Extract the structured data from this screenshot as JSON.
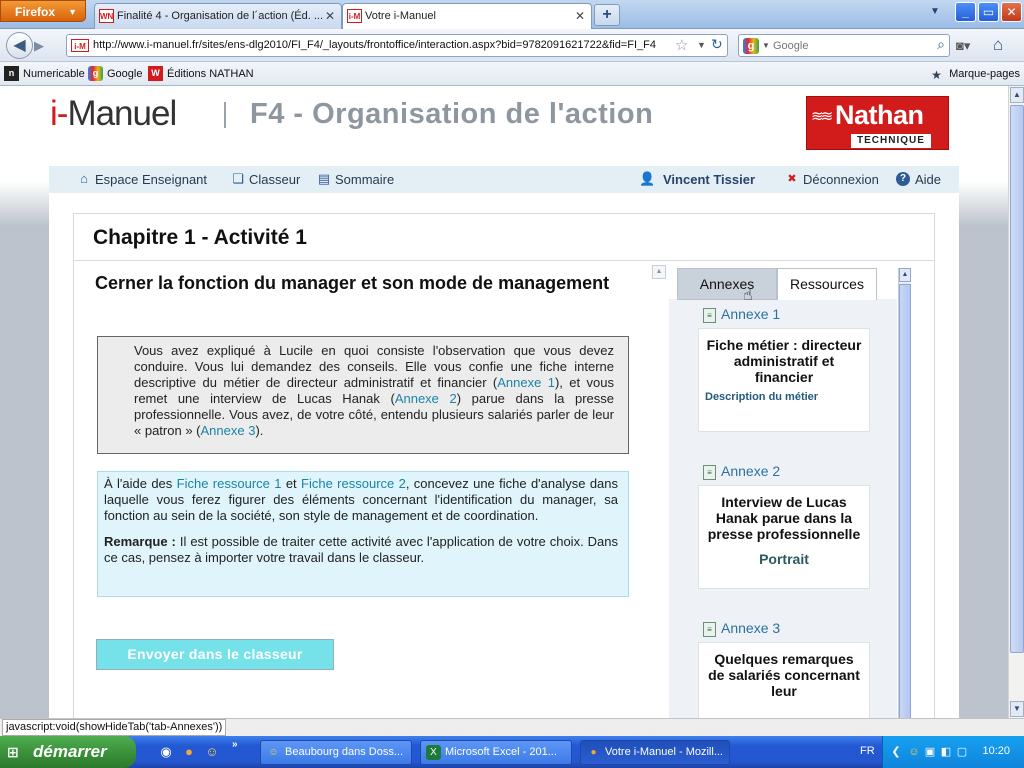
{
  "browser": {
    "menu_button": "Firefox",
    "tabs": [
      {
        "title": "Finalité 4 - Organisation de l´action (Éd. ...",
        "icon": "nathan-favicon-icon"
      },
      {
        "title": "Votre i-Manuel",
        "icon": "imanuel-favicon-icon"
      }
    ],
    "url": "http://www.i-manuel.fr/sites/ens-dlg2010/FI_F4/_layouts/frontoffice/interaction.aspx?bid=9782091621722&fid=FI_F4",
    "search_placeholder": "Google",
    "bookmarks": [
      "Numericable",
      "Google",
      "Éditions NATHAN"
    ],
    "bookmarks_menu": "Marque-pages",
    "status_text": "javascript:void(showHideTab('tab-Annexes'))"
  },
  "header": {
    "logo_prefix": "i-",
    "logo_name": "Manuel",
    "title": "F4 - Organisation de l'action",
    "publisher": "Nathan",
    "publisher_sub": "TECHNIQUE"
  },
  "nav": {
    "espace": "Espace Enseignant",
    "classeur": "Classeur",
    "sommaire": "Sommaire",
    "user": "Vincent Tissier",
    "logout": "Déconnexion",
    "help": "Aide"
  },
  "chapter": {
    "title": "Chapitre 1 - Activité 1"
  },
  "activity": {
    "title": "Cerner la fonction du manager et son mode de management",
    "context_1": "Vous avez expliqué à Lucile en quoi consiste l'observation que vous devez conduire. Vous lui demandez des conseils. Elle vous confie une fiche interne descriptive du métier de directeur administratif et financier (",
    "link_annexe1": "Annexe 1",
    "context_2": "), et vous remet une interview de Lucas Hanak (",
    "link_annexe2": "Annexe 2",
    "context_3": ") parue dans la presse professionnelle. Vous avez, de votre côté, entendu plusieurs salariés parler de leur « patron » (",
    "link_annexe3": "Annexe 3",
    "context_4": ").",
    "consigne_1": "À l'aide des ",
    "link_fiche1": "Fiche ressource 1",
    "consigne_2": " et ",
    "link_fiche2": "Fiche ressource 2",
    "consigne_3": ", concevez une fiche d'analyse dans laquelle vous ferez figurer des éléments concernant l'identification du manager, sa fonction au sein de la société, son style de management et de coordination.",
    "remark_label": "Remarque :",
    "remark_text": " Il est possible de traiter cette activité avec l'application de votre choix. Dans ce cas, pensez à importer votre travail dans le classeur.",
    "send_button": "Envoyer dans le classeur"
  },
  "panel": {
    "tab_annexes": "Annexes",
    "tab_ressources": "Ressources",
    "annexes": [
      {
        "label": "Annexe 1",
        "title": "Fiche métier : directeur administratif et financier",
        "subtitle": "Description du métier"
      },
      {
        "label": "Annexe 2",
        "title": "Interview de Lucas Hanak parue dans la presse professionnelle",
        "subtitle": "Portrait"
      },
      {
        "label": "Annexe 3",
        "title": "Quelques remarques de salariés concernant leur",
        "subtitle": ""
      }
    ]
  },
  "taskbar": {
    "start": "démarrer",
    "tasks": [
      "Beaubourg dans Doss...",
      "Microsoft Excel - 201...",
      "Votre i-Manuel - Mozill..."
    ],
    "lang": "FR",
    "clock": "10:20"
  }
}
